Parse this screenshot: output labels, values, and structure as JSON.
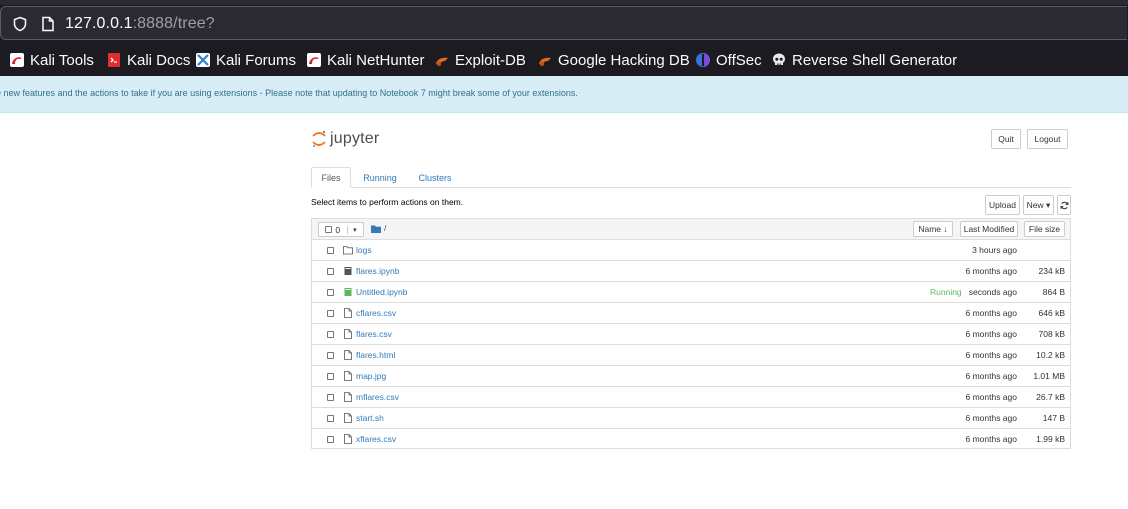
{
  "browser": {
    "url_host": "127.0.0.1",
    "url_rest": ":8888/tree?"
  },
  "bookmarks": [
    {
      "label": "Kali Tools",
      "icon": "kali-dragon-icon"
    },
    {
      "label": "Kali Docs",
      "icon": "kali-docs-icon"
    },
    {
      "label": "Kali Forums",
      "icon": "kali-forums-icon"
    },
    {
      "label": "Kali NetHunter",
      "icon": "kali-dragon-icon"
    },
    {
      "label": "Exploit-DB",
      "icon": "exploit-db-icon"
    },
    {
      "label": "Google Hacking DB",
      "icon": "exploit-db-icon"
    },
    {
      "label": "OffSec",
      "icon": "offsec-icon"
    },
    {
      "label": "Reverse Shell Generator",
      "icon": "skull-icon"
    }
  ],
  "banner": {
    "text": "e new features and the actions to take if you are using extensions - Please note that updating to Notebook 7 might break some of your extensions."
  },
  "header": {
    "logo_text": "jupyter",
    "quit_label": "Quit",
    "logout_label": "Logout"
  },
  "tabs": [
    {
      "label": "Files"
    },
    {
      "label": "Running"
    },
    {
      "label": "Clusters"
    }
  ],
  "toolbar": {
    "hint": "Select items to perform actions on them.",
    "upload_label": "Upload",
    "new_label": "New ▾",
    "refresh_icon": "refresh-icon"
  },
  "list_header": {
    "selected_count": "0",
    "path": "/",
    "name_label": "Name ↓",
    "modified_label": "Last Modified",
    "size_label": "File size"
  },
  "files": [
    {
      "name": "logs",
      "type": "folder",
      "modified": "3 hours ago",
      "size": "",
      "status": ""
    },
    {
      "name": "flares.ipynb",
      "type": "notebook",
      "modified": "6 months ago",
      "size": "234 kB",
      "status": ""
    },
    {
      "name": "Untitled.ipynb",
      "type": "notebook-running",
      "modified": "seconds ago",
      "size": "864 B",
      "status": "Running"
    },
    {
      "name": "cflares.csv",
      "type": "file",
      "modified": "6 months ago",
      "size": "646 kB",
      "status": ""
    },
    {
      "name": "flares.csv",
      "type": "file",
      "modified": "6 months ago",
      "size": "708 kB",
      "status": ""
    },
    {
      "name": "flares.html",
      "type": "file",
      "modified": "6 months ago",
      "size": "10.2 kB",
      "status": ""
    },
    {
      "name": "map.jpg",
      "type": "file",
      "modified": "6 months ago",
      "size": "1.01 MB",
      "status": ""
    },
    {
      "name": "mflares.csv",
      "type": "file",
      "modified": "6 months ago",
      "size": "26.7 kB",
      "status": ""
    },
    {
      "name": "start.sh",
      "type": "file",
      "modified": "6 months ago",
      "size": "147 B",
      "status": ""
    },
    {
      "name": "xflares.csv",
      "type": "file",
      "modified": "6 months ago",
      "size": "1.99 kB",
      "status": ""
    }
  ]
}
